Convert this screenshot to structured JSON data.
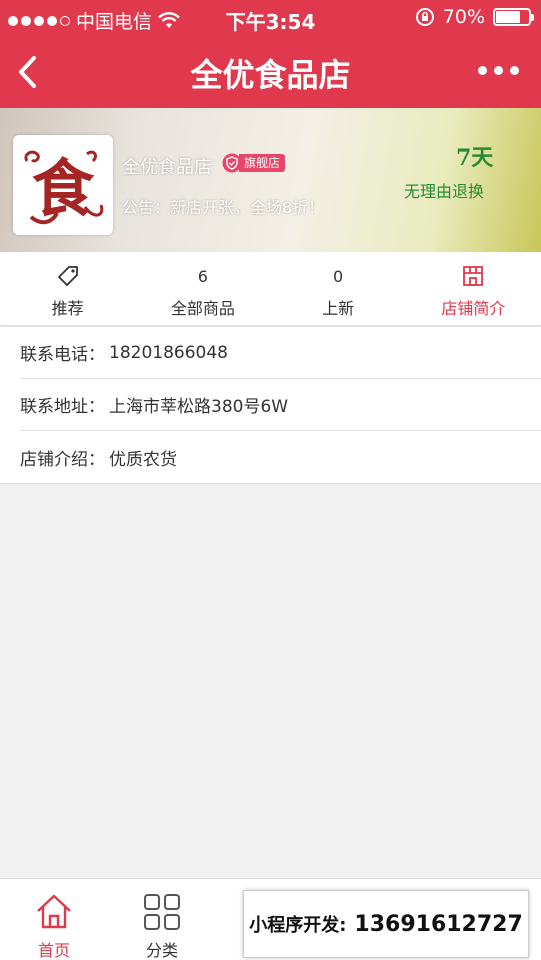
{
  "status_bar": {
    "carrier": "中国电信",
    "time": "下午3:54",
    "battery": "70%",
    "battery_level": 0.7
  },
  "nav": {
    "title": "全优食品店",
    "back_icon": "chevron-left-icon",
    "more_icon": "more-dots-icon"
  },
  "store": {
    "name": "全优食品店",
    "badge": "旗舰店",
    "notice": "公告：新店开张，全场8折！",
    "return_days": "7天",
    "return_policy": "无理由退换",
    "logo_char": "食"
  },
  "tabs": [
    {
      "top": "",
      "label": "推荐",
      "icon": "tag-icon"
    },
    {
      "top": "6",
      "label": "全部商品"
    },
    {
      "top": "0",
      "label": "上新"
    },
    {
      "top": "",
      "label": "店铺简介",
      "icon": "store-icon"
    }
  ],
  "info": {
    "phone_label": "联系电话：",
    "phone": "18201866048",
    "address_label": "联系地址：",
    "address": "上海市莘松路380号6W",
    "intro_label": "店铺介绍：",
    "intro": "优质农货"
  },
  "bottom_nav": [
    {
      "label": "首页",
      "icon": "home-icon"
    },
    {
      "label": "分类",
      "icon": "grid-icon"
    }
  ],
  "promo": {
    "label": "小程序开发:",
    "phone": "13691612727"
  },
  "colors": {
    "primary": "#e0394e",
    "green": "#2a8a34"
  }
}
